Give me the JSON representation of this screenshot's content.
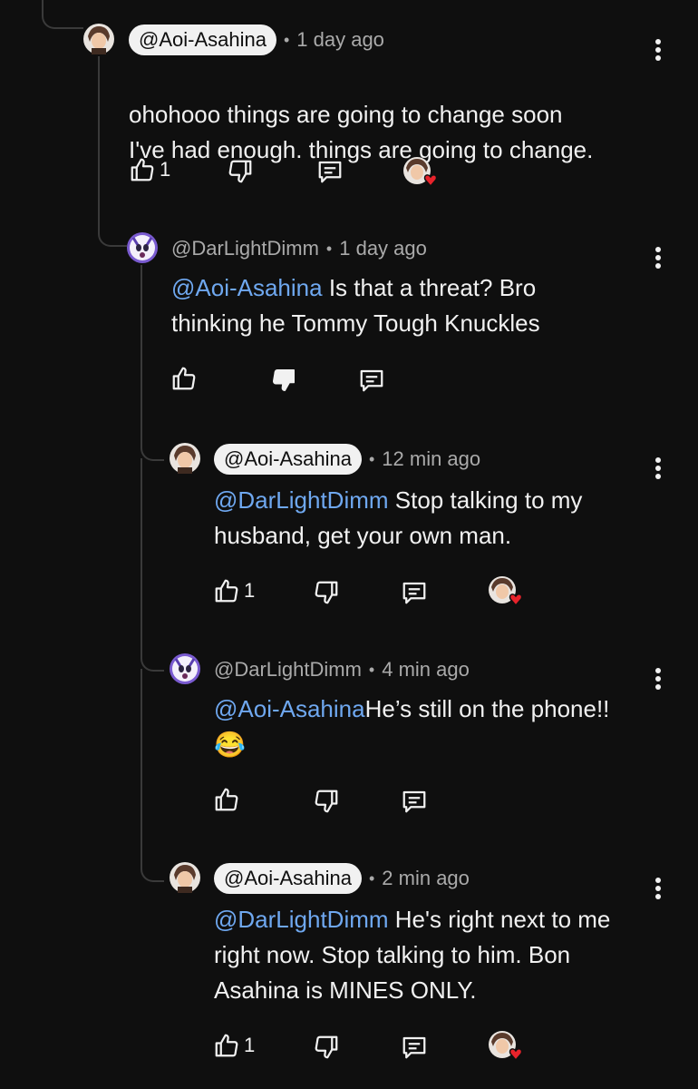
{
  "comments": [
    {
      "handle": "@Aoi-Asahina",
      "pill": true,
      "time": "1 day ago",
      "mention": "",
      "text": "ohohooo things are going to change soon\nI've had enough. things are going to change.",
      "likes": "1",
      "hearted": true
    },
    {
      "handle": "@DarLightDimm",
      "pill": false,
      "time": "1 day ago",
      "mention": "@Aoi-Asahina",
      "text": " Is that a threat? Bro\nthinking he Tommy Tough Knuckles",
      "likes": "",
      "hearted": false
    },
    {
      "handle": "@Aoi-Asahina",
      "pill": true,
      "time": "12 min ago",
      "mention": "@DarLightDimm",
      "text": " Stop talking to my\nhusband, get your own man.",
      "likes": "1",
      "hearted": true
    },
    {
      "handle": "@DarLightDimm",
      "pill": false,
      "time": "4 min ago",
      "mention": "@Aoi-Asahina",
      "text": "He’s still on the phone!!",
      "emoji": "😂",
      "likes": "",
      "hearted": false
    },
    {
      "handle": "@Aoi-Asahina",
      "pill": true,
      "time": "2 min ago",
      "mention": "@DarLightDimm",
      "text": " He's right next to me\nright now. Stop talking to him. Bon\nAsahina is MINES ONLY.",
      "likes": "1",
      "hearted": true
    }
  ],
  "separator": "•",
  "icons": {
    "like": "thumbs-up-icon",
    "dislike": "thumbs-down-icon",
    "reply": "reply-icon",
    "menu": "more-vertical-icon",
    "heart": "creator-heart-icon"
  },
  "colors": {
    "background": "#0f0f0f",
    "mention": "#6fa8f0",
    "heart": "#e8232b"
  }
}
